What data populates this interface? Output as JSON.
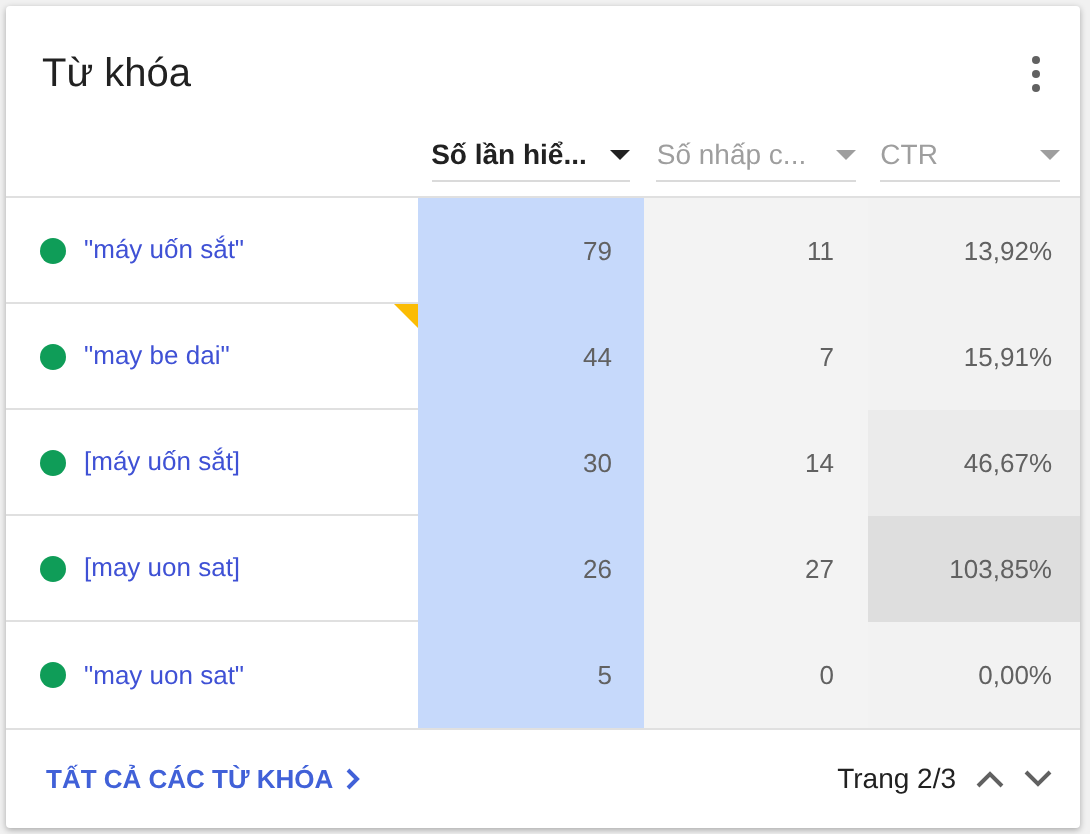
{
  "title": "Từ khóa",
  "columns": [
    {
      "label": "Số lần hiể...",
      "selected": true
    },
    {
      "label": "Số nhấp c...",
      "selected": false
    },
    {
      "label": "CTR",
      "selected": false
    }
  ],
  "rows": [
    {
      "keyword": "\"máy uốn sắt\"",
      "color": "#0f9d58",
      "impressions": "79",
      "clicks": "11",
      "ctr": {
        "text": "13,92%",
        "color": "#f2f2f2"
      },
      "flagged": false
    },
    {
      "keyword": "\"may be dai\"",
      "color": "#0f9d58",
      "impressions": "44",
      "clicks": "7",
      "ctr": {
        "text": "15,91%",
        "color": "#f2f2f2"
      },
      "flagged": true
    },
    {
      "keyword": "[máy uốn sắt]",
      "color": "#0f9d58",
      "impressions": "30",
      "clicks": "14",
      "ctr": {
        "text": "46,67%",
        "color": "#ebebeb"
      },
      "flagged": false
    },
    {
      "keyword": "[may uon sat]",
      "color": "#0f9d58",
      "impressions": "26",
      "clicks": "27",
      "ctr": {
        "text": "103,85%",
        "color": "#dedede"
      },
      "flagged": false
    },
    {
      "keyword": "\"may uon sat\"",
      "color": "#0f9d58",
      "impressions": "5",
      "clicks": "0",
      "ctr": {
        "text": "0,00%",
        "color": "#f2f2f2"
      },
      "flagged": false
    }
  ],
  "footer": {
    "link": "TẤT CẢ CÁC TỪ KHÓA",
    "page": "Trang 2/3"
  }
}
